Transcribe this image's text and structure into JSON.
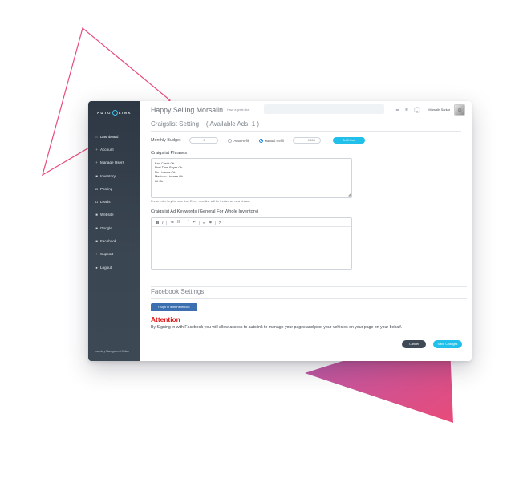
{
  "brand": {
    "logo_left": "AUTO",
    "logo_right": "LINK",
    "tagline": "Inventory Management Option"
  },
  "colors": {
    "accent": "#21c0ea",
    "sidebar": "#36414d",
    "facebook": "#3b6fb0",
    "attention": "#e01a1a",
    "deco_pink": "#e84b7a",
    "deco_purple": "#b35bb0"
  },
  "sidebar": {
    "items": [
      {
        "icon": "dashboard-icon",
        "glyph": "⌂",
        "label": "Dashboard"
      },
      {
        "icon": "plus-icon",
        "glyph": "+",
        "label": "Account"
      },
      {
        "icon": "plus-icon",
        "glyph": "+",
        "label": "Manage Users"
      },
      {
        "icon": "inventory-icon",
        "glyph": "■",
        "label": "Inventory"
      },
      {
        "icon": "posting-icon",
        "glyph": "◘",
        "label": "Posting"
      },
      {
        "icon": "leads-icon",
        "glyph": "◘",
        "label": "Leads"
      },
      {
        "icon": "website-icon",
        "glyph": "■",
        "label": "Website"
      },
      {
        "icon": "google-icon",
        "glyph": "■",
        "label": "Google"
      },
      {
        "icon": "facebook-icon",
        "glyph": "■",
        "label": "Facebook"
      },
      {
        "icon": "plus-icon",
        "glyph": "+",
        "label": "Support"
      },
      {
        "icon": "logout-icon",
        "glyph": "●",
        "label": "Logout"
      }
    ]
  },
  "header": {
    "greeting": "Happy Selling Morsalin",
    "subtext": "Have a great deal",
    "username": "Morsalin Sarkar"
  },
  "craigslist": {
    "title": "Craigslist Setting",
    "available": "( Available Ads: 1 )",
    "budget_label": "Monthly Budget",
    "budget_value": "0",
    "auto_refill": "Auto Refill",
    "manual_refill": "Manual Refill",
    "refill_value": "0.00$",
    "refill_button": "Refill Now",
    "phrases_label": "Craigslist Phrases",
    "phrases": [
      "Bad Credit Ok",
      "First Time Buyer Ok",
      "No License Ok",
      "Mexican License Ok",
      "Itit Ok"
    ],
    "phrases_hint": "Press enter key for new line. Every new line will be treated as new phrase",
    "keywords_label": "Craigslist Ad Keywords (General For Whole Inventory)",
    "toolbar": [
      "B",
      "I",
      "≔",
      "☷",
      "❝",
      "⇤",
      "∞",
      "⇆",
      "?"
    ]
  },
  "facebook": {
    "title": "Facebook Settings",
    "signin_button": "f  Sign in with Facebook",
    "attention": "Attention",
    "attention_text": "By Signing in with Facebook you will allow access to autolink to manage your pages and post your vehicles on your page on your behalf."
  },
  "actions": {
    "cancel": "Cancel",
    "save": "Save Changes"
  }
}
